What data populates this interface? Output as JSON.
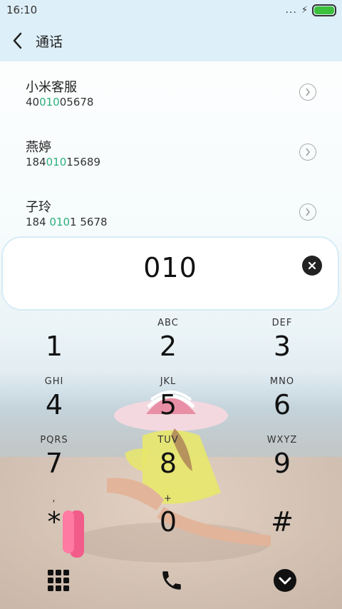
{
  "status_bar": {
    "time": "16:10",
    "more": "...",
    "battery_level": 1.0,
    "charging_icon": "bolt-icon"
  },
  "header": {
    "title": "通话"
  },
  "contacts": [
    {
      "name": "小米客服",
      "num_before": "40",
      "num_match": "010",
      "num_after": "05678"
    },
    {
      "name": "燕婷",
      "num_before": "184",
      "num_match": "010",
      "num_after": "15689"
    },
    {
      "name": "子玲",
      "num_before": "184 ",
      "num_match": "010",
      "num_after": "1 5678"
    }
  ],
  "dial_input": {
    "value": "010"
  },
  "keypad": {
    "keys": [
      {
        "digit": "1",
        "letters": ""
      },
      {
        "digit": "2",
        "letters": "ABC"
      },
      {
        "digit": "3",
        "letters": "DEF"
      },
      {
        "digit": "4",
        "letters": "GHI"
      },
      {
        "digit": "5",
        "letters": "JKL"
      },
      {
        "digit": "6",
        "letters": "MNO"
      },
      {
        "digit": "7",
        "letters": "PQRS"
      },
      {
        "digit": "8",
        "letters": "TUV"
      },
      {
        "digit": "9",
        "letters": "WXYZ"
      },
      {
        "digit": "*",
        "letters": ","
      },
      {
        "digit": "0",
        "letters": "+"
      },
      {
        "digit": "#",
        "letters": ""
      }
    ]
  },
  "colors": {
    "match_highlight": "#2bb07a",
    "header_bg": "#ddeff8",
    "battery": "#3cc13c"
  }
}
